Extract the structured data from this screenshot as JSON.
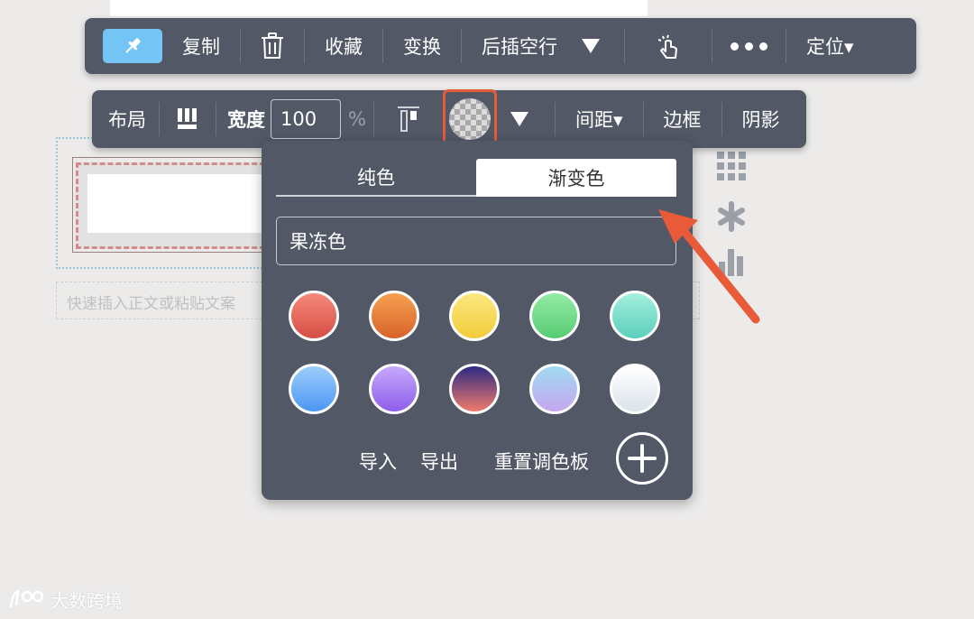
{
  "toolbar_top": {
    "copy": "复制",
    "favorite": "收藏",
    "transform": "变换",
    "insert_after": "后插空行",
    "locate": "定位▾"
  },
  "toolbar_style": {
    "layout": "布局",
    "width_label": "宽度",
    "width_value": "100",
    "percent": "%",
    "spacing": "间距▾",
    "border": "边框",
    "shadow": "阴影"
  },
  "canvas": {
    "quick_insert_placeholder": "快速插入正文或粘贴文案"
  },
  "color_popover": {
    "tabs": [
      "纯色",
      "渐变色"
    ],
    "active_tab": "渐变色",
    "palette_select": "果冻色",
    "swatches": [
      [
        "#f58a7a",
        "#d64d44"
      ],
      [
        "#f5a050",
        "#d8632a"
      ],
      [
        "#fbe77e",
        "#f3cc3c"
      ],
      [
        "#94eba3",
        "#57cc75"
      ],
      [
        "#a4f0de",
        "#5bcfba"
      ],
      [
        "#9ccdfc",
        "#4c97f2"
      ],
      [
        "#c6a9fb",
        "#8e5eeb"
      ],
      [
        "#2d2a83",
        "#ef7a6c"
      ],
      [
        "#9fdbf0",
        "#c7a6f0"
      ],
      [
        "#ffffff",
        "#dbe2ec"
      ]
    ],
    "import": "导入",
    "export": "导出",
    "reset": "重置调色板"
  },
  "watermark": {
    "text": "大数跨境"
  },
  "colors": {
    "toolbar_bg": "#525866",
    "pin_active": "#74c5f6",
    "highlight": "#e55b3a"
  }
}
